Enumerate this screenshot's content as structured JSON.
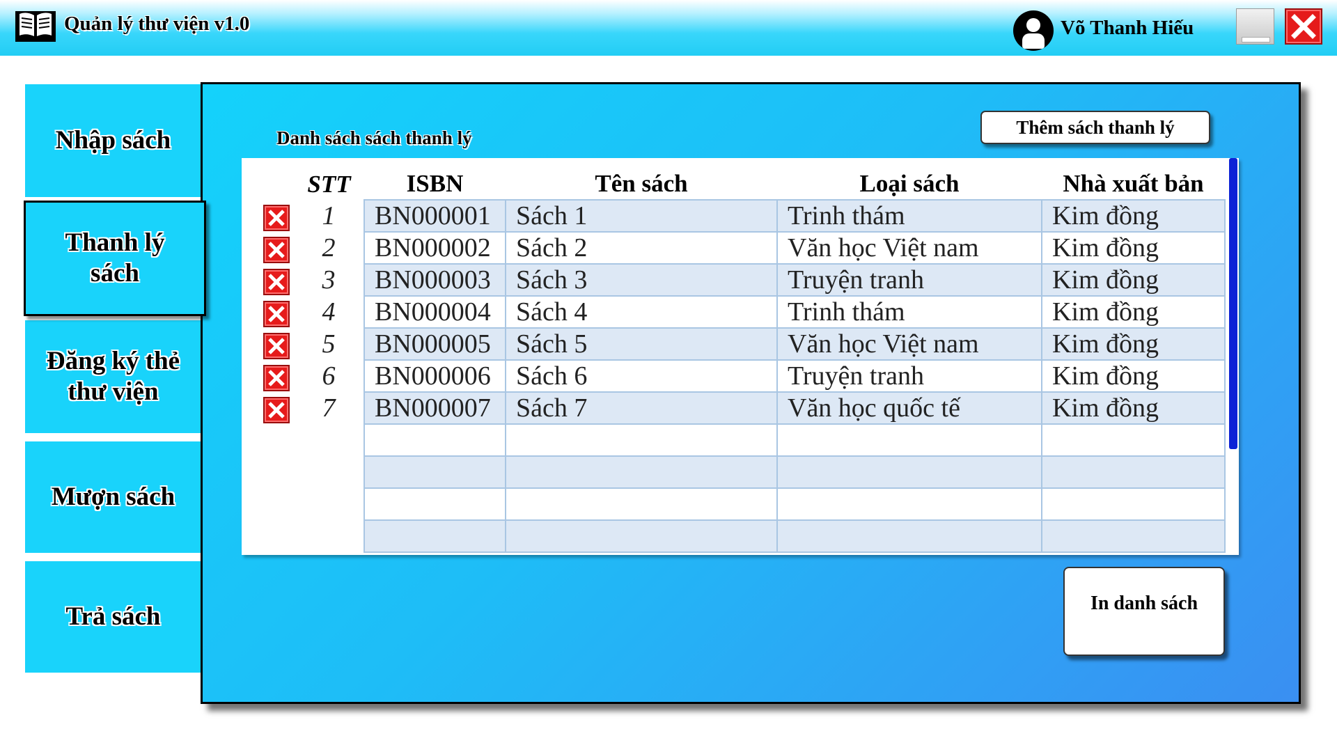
{
  "app": {
    "title": "Quản lý thư viện v1.0",
    "user_name": "Võ Thanh Hiếu"
  },
  "window_controls": {
    "minimize_icon": "minimize-icon",
    "close_icon": "close-icon",
    "close_color": "#e51b1b"
  },
  "sidebar": {
    "items": [
      {
        "label": "Nhập sách",
        "active": false
      },
      {
        "label": "Thanh lý sách",
        "active": true
      },
      {
        "label": "Đăng ký thẻ thư viện",
        "active": false
      },
      {
        "label": "Mượn sách",
        "active": false
      },
      {
        "label": "Trả sách",
        "active": false
      }
    ]
  },
  "main": {
    "list_title": "Danh sách sách thanh lý",
    "add_button": "Thêm sách thanh lý",
    "print_button": "In danh sách",
    "table": {
      "headers": [
        "STT",
        "ISBN",
        "Tên sách",
        "Loại sách",
        "Nhà xuất bản"
      ],
      "rows": [
        {
          "stt": "1",
          "isbn": "BN000001",
          "title": "Sách 1",
          "category": "Trinh thám",
          "publisher": "Kim đồng"
        },
        {
          "stt": "2",
          "isbn": "BN000002",
          "title": "Sách 2",
          "category": "Văn học Việt nam",
          "publisher": "Kim đồng"
        },
        {
          "stt": "3",
          "isbn": "BN000003",
          "title": "Sách 3",
          "category": "Truyện tranh",
          "publisher": "Kim đồng"
        },
        {
          "stt": "4",
          "isbn": "BN000004",
          "title": "Sách 4",
          "category": "Trinh thám",
          "publisher": "Kim đồng"
        },
        {
          "stt": "5",
          "isbn": "BN000005",
          "title": "Sách 5",
          "category": "Văn học Việt nam",
          "publisher": "Kim đồng"
        },
        {
          "stt": "6",
          "isbn": "BN000006",
          "title": "Sách 6",
          "category": "Truyện tranh",
          "publisher": "Kim đồng"
        },
        {
          "stt": "7",
          "isbn": "BN000007",
          "title": "Sách 7",
          "category": "Văn học quốc tế",
          "publisher": "Kim đồng"
        }
      ],
      "delete_icon": "delete-x-icon"
    }
  }
}
